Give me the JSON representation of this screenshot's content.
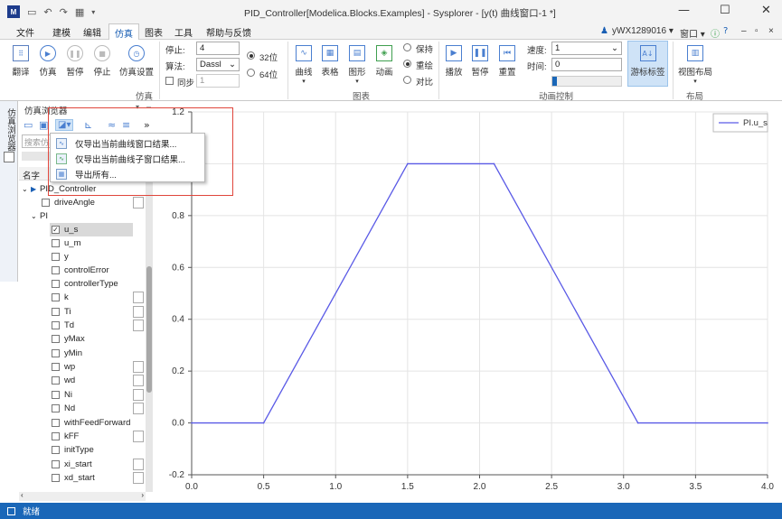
{
  "window": {
    "title": "PID_Controller[Modelica.Blocks.Examples] - Sysplorer - [y(t) 曲线窗口-1 *]",
    "app_icon": "M",
    "minimize": "—",
    "maximize": "☐",
    "close": "✕"
  },
  "menu": {
    "items": [
      "文件",
      "建模",
      "编辑",
      "仿真",
      "图表",
      "工具",
      "帮助与反馈"
    ],
    "active": "仿真",
    "user": "yWX1289016 ▾",
    "window_menu": "窗口 ▾",
    "mdi_controls": [
      "–",
      "▫",
      "×"
    ]
  },
  "ribbon": {
    "buttons": {
      "translate": "翻译",
      "simulate": "仿真",
      "pause": "暂停",
      "stop": "停止",
      "sim_settings": "仿真设置",
      "curve": "曲线",
      "table": "表格",
      "graphic": "图形",
      "animation": "动画",
      "play": "播放",
      "pause_anim": "暂停",
      "reset": "重置",
      "cursor_label": "游标标签",
      "view_layout": "视图布局"
    },
    "fields": {
      "stop_label": "停止:",
      "stop_value": "4",
      "algorithm_label": "算法:",
      "algorithm_value": "Dassl",
      "sync_label": "同步",
      "sync_value": "1",
      "bit32": "32位",
      "bit64": "64位",
      "keep": "保持",
      "overlay": "重绘",
      "compare": "对比",
      "speed_label": "速度:",
      "speed_value": "1",
      "time_label": "时间:",
      "time_value": "0"
    },
    "groups": {
      "simulation": "仿真",
      "chart": "图表",
      "animation_control": "动画控制",
      "layout": "布局"
    }
  },
  "sidebar": {
    "vertical_tab": "仿真浏览器",
    "panel_title": "仿真浏览器",
    "search_placeholder": "搜索仿真",
    "column_name": "名字",
    "tree": [
      {
        "label": "PID_Controller",
        "level": 0,
        "type": "root"
      },
      {
        "label": "driveAngle",
        "level": 1,
        "type": "check"
      },
      {
        "label": "PI",
        "level": 1,
        "type": "group"
      },
      {
        "label": "u_s",
        "level": 2,
        "type": "check",
        "checked": true,
        "selected": true
      },
      {
        "label": "u_m",
        "level": 2,
        "type": "check"
      },
      {
        "label": "y",
        "level": 2,
        "type": "check"
      },
      {
        "label": "controlError",
        "level": 2,
        "type": "check"
      },
      {
        "label": "controllerType",
        "level": 2,
        "type": "check"
      },
      {
        "label": "k",
        "level": 2,
        "type": "check"
      },
      {
        "label": "Ti",
        "level": 2,
        "type": "check"
      },
      {
        "label": "Td",
        "level": 2,
        "type": "check"
      },
      {
        "label": "yMax",
        "level": 2,
        "type": "check"
      },
      {
        "label": "yMin",
        "level": 2,
        "type": "check"
      },
      {
        "label": "wp",
        "level": 2,
        "type": "check"
      },
      {
        "label": "wd",
        "level": 2,
        "type": "check"
      },
      {
        "label": "Ni",
        "level": 2,
        "type": "check"
      },
      {
        "label": "Nd",
        "level": 2,
        "type": "check"
      },
      {
        "label": "withFeedForward",
        "level": 2,
        "type": "check"
      },
      {
        "label": "kFF",
        "level": 2,
        "type": "check"
      },
      {
        "label": "initType",
        "level": 2,
        "type": "check"
      },
      {
        "label": "xi_start",
        "level": 2,
        "type": "check"
      },
      {
        "label": "xd_start",
        "level": 2,
        "type": "check"
      }
    ]
  },
  "export_menu": {
    "items": [
      "仅导出当前曲线窗口结果...",
      "仅导出当前曲线子窗口结果...",
      "导出所有..."
    ]
  },
  "chart_data": {
    "type": "line",
    "series": [
      {
        "name": "PI.u_s",
        "color": "#5a5ae6",
        "x": [
          0,
          0.5,
          1.5,
          2.1,
          3.1,
          4.0
        ],
        "y": [
          0,
          0,
          1,
          1,
          0,
          0
        ]
      }
    ],
    "xlim": [
      0,
      4.0
    ],
    "ylim": [
      -0.2,
      1.2
    ],
    "xticks": [
      "0.0",
      "0.5",
      "1.0",
      "1.5",
      "2.0",
      "2.5",
      "3.0",
      "3.5",
      "4.0"
    ],
    "yticks": [
      "-0.2",
      "0.0",
      "0.2",
      "0.4",
      "0.6",
      "0.8",
      "1.0",
      "1.2"
    ],
    "grid": true,
    "legend": "top-right"
  },
  "status": {
    "text": "就绪"
  }
}
